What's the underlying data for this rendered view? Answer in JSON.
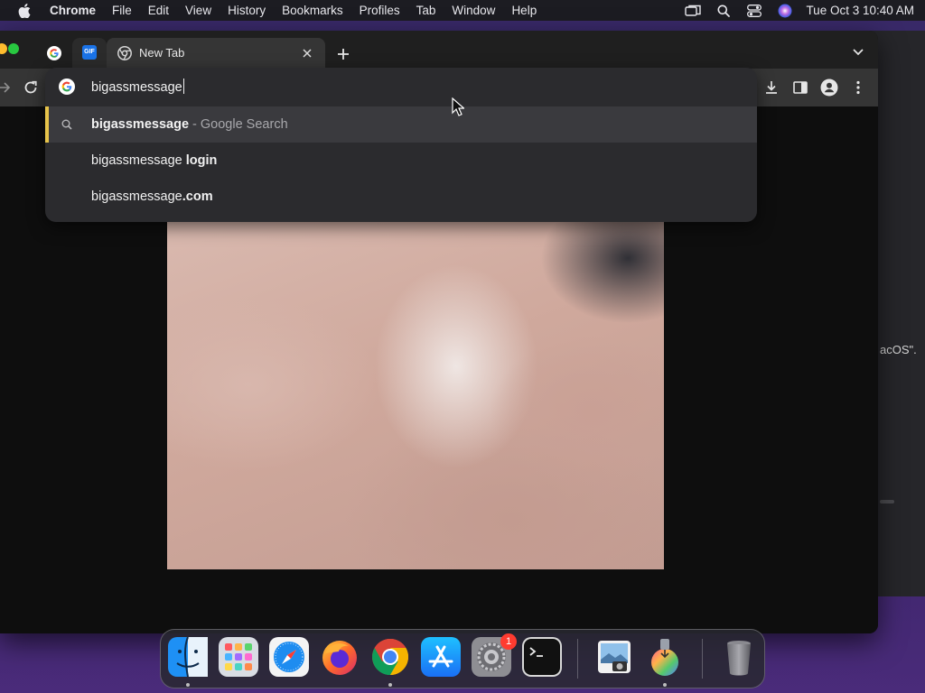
{
  "menubar": {
    "app_name": "Chrome",
    "items": [
      "File",
      "Edit",
      "View",
      "History",
      "Bookmarks",
      "Profiles",
      "Tab",
      "Window",
      "Help"
    ],
    "clock": "Tue Oct 3  10:40 AM"
  },
  "browser": {
    "active_tab_title": "New Tab",
    "gif_tab_favicon_text": "GIF",
    "omnibox": {
      "query": "bigassmessage",
      "suggestions": [
        {
          "bold": "bigassmessage",
          "rest": "",
          "suffix": " - Google Search"
        },
        {
          "prefix": "bigassmessage ",
          "bold": "login"
        },
        {
          "prefix": "bigassmessage",
          "bold": ".com"
        }
      ]
    }
  },
  "background_window": {
    "partial_text": "acOS\"."
  },
  "dock": {
    "settings_badge": "1",
    "icons": [
      "finder-icon",
      "launchpad-icon",
      "safari-icon",
      "firefox-icon",
      "chrome-icon",
      "app-store-icon",
      "system-settings-icon",
      "terminal-icon",
      "preview-icon",
      "installer-icon",
      "trash-icon"
    ]
  },
  "colors": {
    "accent_yellow": "#e6c34a",
    "badge_red": "#ff3b30"
  }
}
